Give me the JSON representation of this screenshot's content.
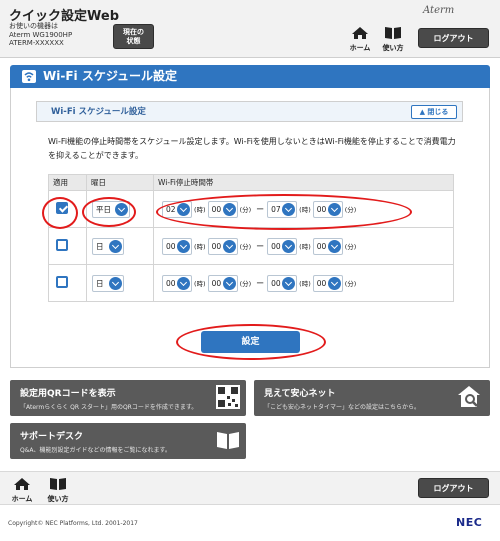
{
  "header": {
    "app_title": "クイック設定Web",
    "device_label": "お使いの機器は",
    "device_model": "Aterm WG1900HP",
    "device_name": "ATERM-XXXXXX",
    "status_button": [
      "現在の",
      "状態"
    ],
    "brand": "Aterm",
    "home_label": "ホーム",
    "usage_label": "使い方",
    "logout_label": "ログアウト"
  },
  "page": {
    "title": "Wi-Fi スケジュール設定",
    "section_title": "Wi-Fi スケジュール設定",
    "close_label": "閉じる",
    "description": "Wi-Fi機能の停止時間帯をスケジュール設定します。Wi-Fiを使用しないときはWi-Fi機能を停止することで消費電力を抑えることができます。"
  },
  "table": {
    "headers": [
      "適用",
      "曜日",
      "Wi-Fi停止時間帯"
    ],
    "units": {
      "hour": "(時)",
      "minute": "(分)",
      "dash": "ー"
    },
    "rows": [
      {
        "apply": true,
        "day": "平日",
        "start_h": "02",
        "start_m": "00",
        "end_h": "07",
        "end_m": "00"
      },
      {
        "apply": false,
        "day": "日",
        "start_h": "00",
        "start_m": "00",
        "end_h": "00",
        "end_m": "00"
      },
      {
        "apply": false,
        "day": "日",
        "start_h": "00",
        "start_m": "00",
        "end_h": "00",
        "end_m": "00"
      }
    ]
  },
  "set_button": "設定",
  "links": {
    "qr_title": "設定用QRコードを表示",
    "qr_sub": "「Atermらくらく QR スタート」用のQRコードを作成できます。",
    "safe_title": "見えて安心ネット",
    "safe_sub": "「こども安心ネットタイマー」などの設定はこちらから。",
    "support_title": "サポートデスク",
    "support_sub": "Q&A、機能別設定ガイドなどの情報をご覧になれます。"
  },
  "footer": {
    "home_label": "ホーム",
    "usage_label": "使い方",
    "logout_label": "ログアウト",
    "copyright": "Copyright© NEC Platforms, Ltd. 2001-2017",
    "nec": "NEC"
  },
  "colors": {
    "accent": "#2f75c0",
    "highlight": "#e21b1b",
    "dark_button": "#4a4a4a",
    "card": "#5a5a5a"
  }
}
